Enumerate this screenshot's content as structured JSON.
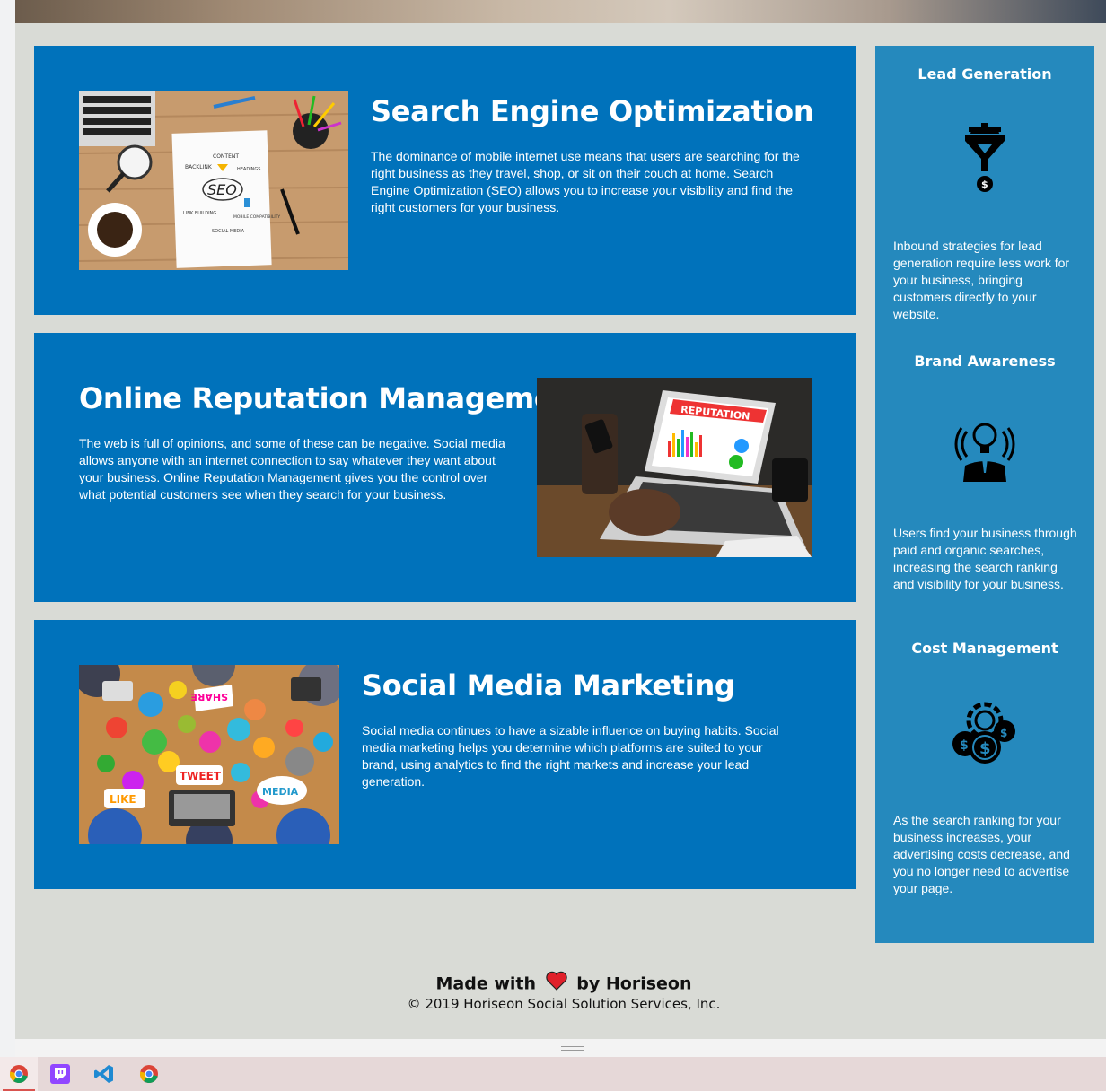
{
  "services": [
    {
      "title": "Search Engine Optimization",
      "body": "The dominance of mobile internet use means that users are searching for the right business as they travel, shop, or sit on their couch at home. Search Engine Optimization (SEO) allows you to increase your visibility and find the right customers for your business.",
      "image_words": [
        "CONTENT",
        "BACKLINK",
        "HEADINGS",
        "SEO",
        "LINK BUILDING",
        "MOBILE COMPATIBILITY",
        "SOCIAL MEDIA"
      ]
    },
    {
      "title": "Online Reputation Management",
      "body": "The web is full of opinions, and some of these can be negative. Social media allows anyone with an internet connection to say whatever they want about your business. Online Reputation Management gives you the control over what potential customers see when they search for your business.",
      "image_words": [
        "REPUTATION"
      ]
    },
    {
      "title": "Social Media Marketing",
      "body": "Social media continues to have a sizable influence on buying habits. Social media marketing helps you determine which platforms are suited to your brand, using analytics to find the right markets and increase your lead generation.",
      "image_words": [
        "SHARE",
        "TWEET",
        "LIKE",
        "MEDIA"
      ]
    }
  ],
  "benefits": [
    {
      "title": "Lead Generation",
      "icon": "lead-funnel-icon",
      "body": "Inbound strategies for lead generation require less work for your business, bringing customers directly to your website."
    },
    {
      "title": "Brand Awareness",
      "icon": "brand-lightbulb-icon",
      "body": "Users find your business through paid and organic searches, increasing the search ranking and visibility for your business."
    },
    {
      "title": "Cost Management",
      "icon": "cost-gear-coins-icon",
      "body": "As the search ranking for your business increases, your advertising costs decrease, and you no longer need to advertise your page."
    }
  ],
  "footer": {
    "made_with": "Made with",
    "by": "by Horiseon",
    "copyright": "© 2019 Horiseon Social Solution Services, Inc."
  },
  "taskbar": {
    "apps": [
      "chrome-icon",
      "twitch-icon",
      "vscode-icon",
      "chrome-icon"
    ]
  },
  "colors": {
    "card_bg": "#0072bb",
    "aside_bg": "#2589bd",
    "page_bg": "#d9dbd6",
    "heart": "#e0202a"
  }
}
